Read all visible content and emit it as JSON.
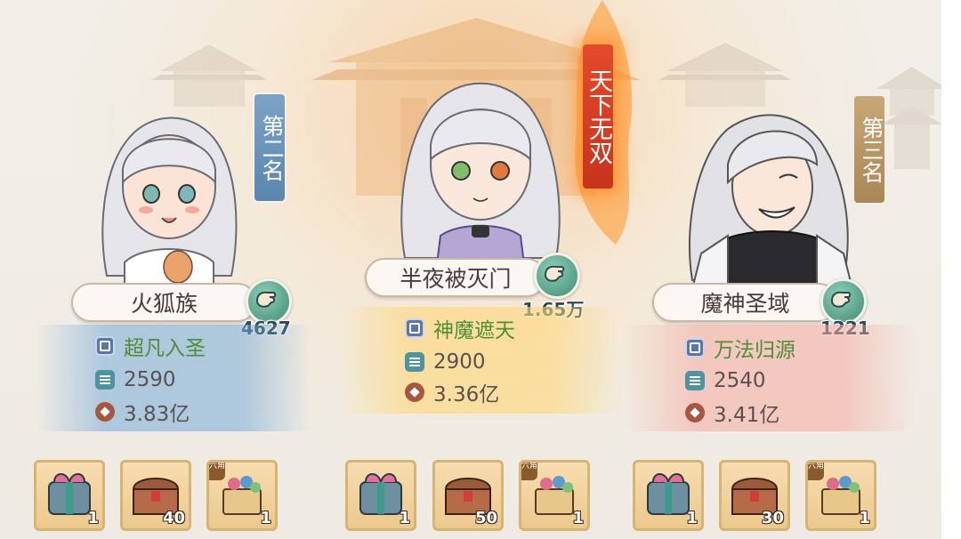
{
  "leaderboard": {
    "entries": [
      {
        "rank_banner": "第二名",
        "name": "火狐族",
        "likes": "4627",
        "realm": "超凡入圣",
        "level": "2590",
        "power": "3.83亿",
        "rewards": [
          {
            "icon": "gift-box-icon",
            "qty": "1"
          },
          {
            "icon": "treasure-chest-icon",
            "qty": "40"
          },
          {
            "icon": "ornate-chest-icon",
            "qty": "1",
            "tag": "六角"
          }
        ]
      },
      {
        "rank_banner": "天下无双",
        "name": "半夜被灭门",
        "likes": "1.65万",
        "realm": "神魔遮天",
        "level": "2900",
        "power": "3.36亿",
        "rewards": [
          {
            "icon": "gift-box-icon",
            "qty": "1"
          },
          {
            "icon": "treasure-chest-icon",
            "qty": "50"
          },
          {
            "icon": "ornate-chest-icon",
            "qty": "1",
            "tag": "六角"
          }
        ]
      },
      {
        "rank_banner": "第三名",
        "name": "魔神圣域",
        "likes": "1221",
        "realm": "万法归源",
        "level": "2540",
        "power": "3.41亿",
        "rewards": [
          {
            "icon": "gift-box-icon",
            "qty": "1"
          },
          {
            "icon": "treasure-chest-icon",
            "qty": "30"
          },
          {
            "icon": "ornate-chest-icon",
            "qty": "1",
            "tag": "六角"
          }
        ]
      }
    ]
  },
  "colors": {
    "realm_text": "#4e8e37",
    "value_text": "#5b5150",
    "banner_second": "#6b94b9",
    "banner_first": "#d83c22",
    "banner_third": "#b9976a"
  }
}
